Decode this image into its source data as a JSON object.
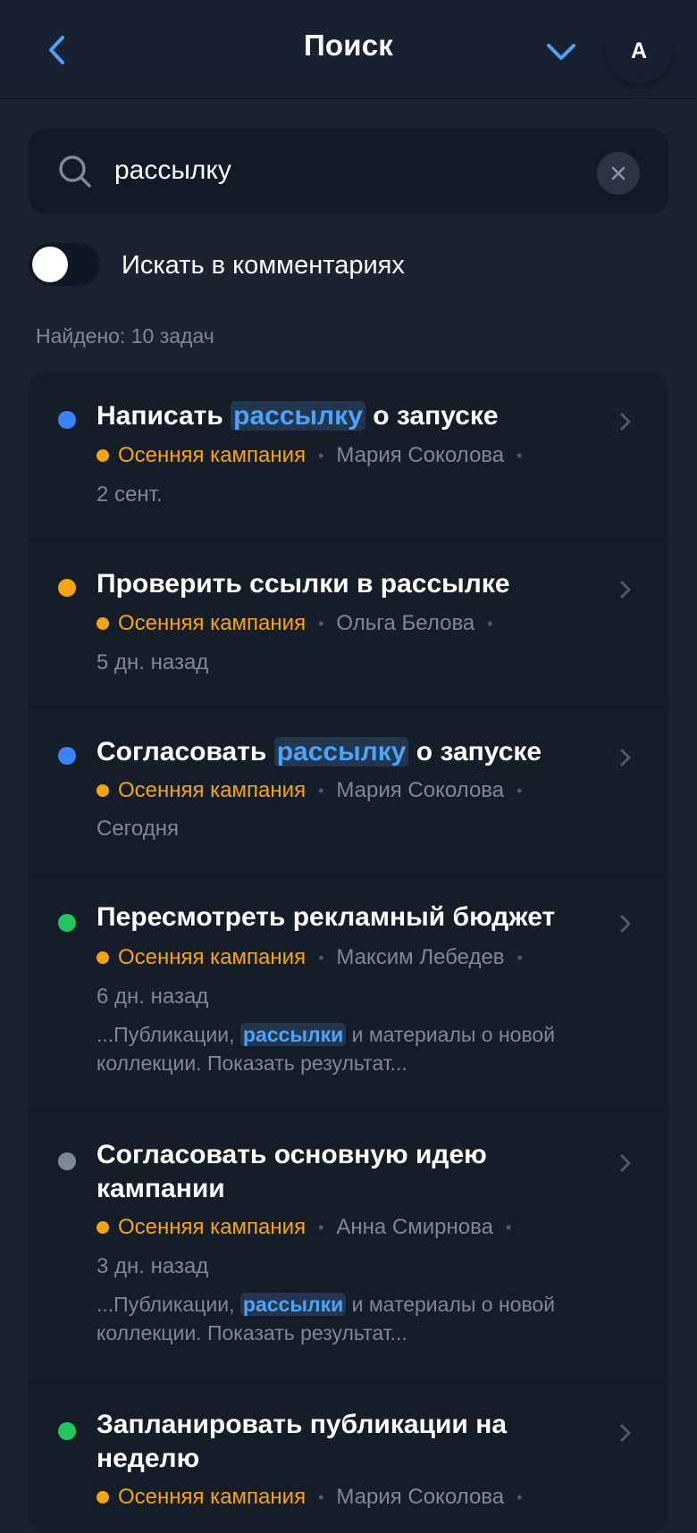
{
  "header": {
    "title": "Поиск",
    "avatar_initial": "А",
    "back_icon": "chevron-left-icon",
    "dropdown_icon": "chevron-down-icon"
  },
  "search": {
    "value": "рассылку",
    "icon": "search-icon",
    "clear_icon": "close-icon"
  },
  "toggle": {
    "label": "Искать в комментариях",
    "on": false
  },
  "results_count": "Найдено: 10 задач",
  "colors": {
    "accent": "#4da3f5",
    "project": "#f5a416",
    "status_blue": "#3b82f6",
    "status_orange": "#f5a416",
    "status_green": "#22c55e",
    "status_gray": "#7d8899"
  },
  "tasks": [
    {
      "title_before": "Написать ",
      "title_highlight": "рассылку",
      "title_after": " о запуске",
      "status_color": "#3b82f6",
      "project": "Осенняя кампания",
      "assignee": "Мария Соколова",
      "date": "2 сент."
    },
    {
      "title_before": "Проверить ссылки в рассылке",
      "title_highlight": "",
      "title_after": "",
      "status_color": "#f5a416",
      "project": "Осенняя кампания",
      "assignee": "Ольга Белова",
      "date": "5 дн. назад"
    },
    {
      "title_before": "Согласовать ",
      "title_highlight": "рассылку",
      "title_after": " о запуске",
      "status_color": "#3b82f6",
      "project": "Осенняя кампания",
      "assignee": "Мария Соколова",
      "date": "Сегодня"
    },
    {
      "title_before": "Пересмотреть рекламный бюджет",
      "title_highlight": "",
      "title_after": "",
      "status_color": "#22c55e",
      "project": "Осенняя кампания",
      "assignee": "Максим Лебедев",
      "date": "6 дн. назад",
      "snippet_before": "...Публикации, ",
      "snippet_highlight": "рассылки",
      "snippet_after": " и материалы о новой коллекции. Показать результат..."
    },
    {
      "title_before": "Согласовать основную идею кампании",
      "title_highlight": "",
      "title_after": "",
      "status_color": "#7d8899",
      "project": "Осенняя кампания",
      "assignee": "Анна Смирнова",
      "date": "3 дн. назад",
      "snippet_before": "...Публикации, ",
      "snippet_highlight": "рассылки",
      "snippet_after": " и материалы о новой коллекции. Показать результат..."
    },
    {
      "title_before": "Запланировать публикации на неделю",
      "title_highlight": "",
      "title_after": "",
      "status_color": "#22c55e",
      "project": "Осенняя кампания",
      "assignee": "Мария Соколова",
      "date": ""
    }
  ]
}
